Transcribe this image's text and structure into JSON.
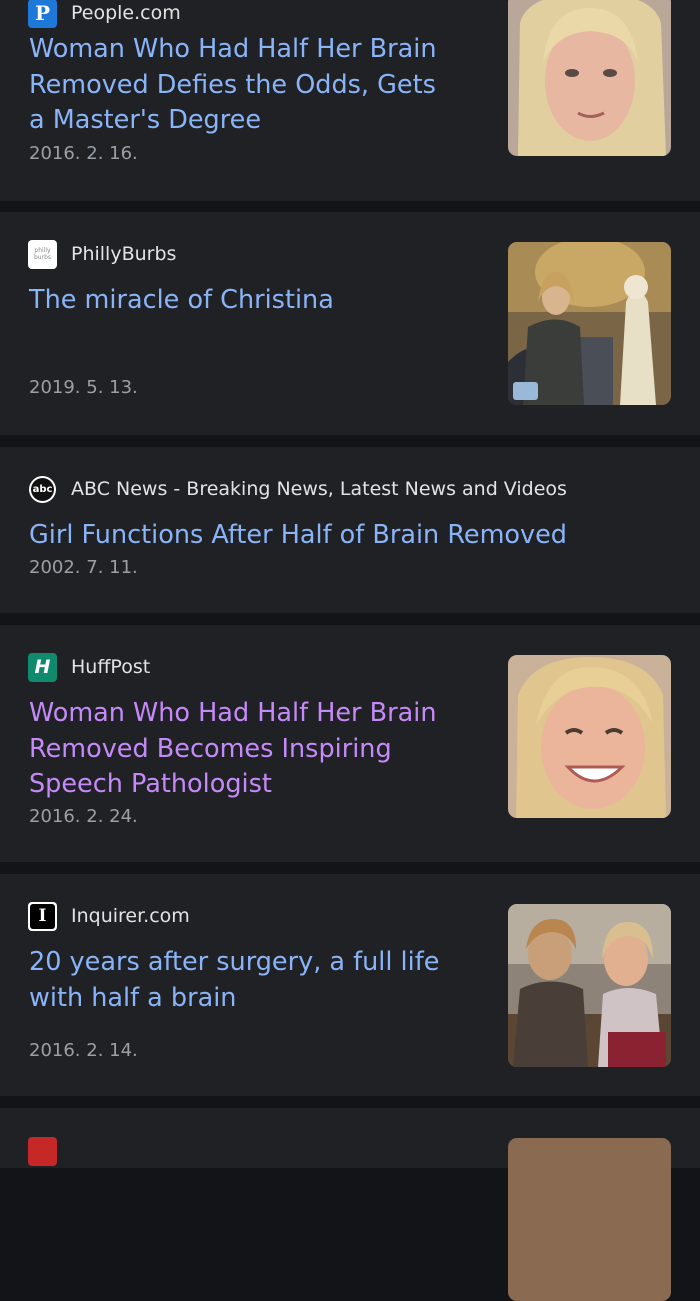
{
  "articles": [
    {
      "source": "People.com",
      "favicon_icon": "people-logo-icon",
      "title": "Woman Who Had Half Her Brain Removed Defies the Odds, Gets a Master's Degree",
      "date": "2016. 2. 16.",
      "visited": false,
      "thumbnail": "blonde-woman-portrait"
    },
    {
      "source": "PhillyBurbs",
      "favicon_icon": "phillyburbs-logo-icon",
      "title": "The miracle of Christina",
      "date": "2019. 5. 13.",
      "visited": false,
      "thumbnail": "woman-beside-statue"
    },
    {
      "source": "ABC News - Breaking News, Latest News and Videos",
      "favicon_icon": "abc-logo-icon",
      "title": "Girl Functions After Half of Brain Removed",
      "date": "2002. 7. 11.",
      "visited": false,
      "thumbnail": null
    },
    {
      "source": "HuffPost",
      "favicon_icon": "huffpost-logo-icon",
      "title": "Woman Who Had Half Her Brain Removed Becomes Inspiring Speech Pathologist",
      "date": "2016. 2. 24.",
      "visited": true,
      "thumbnail": "smiling-woman-portrait"
    },
    {
      "source": "Inquirer.com",
      "favicon_icon": "inquirer-logo-icon",
      "title": "20 years after surgery, a full life with half a brain",
      "date": "2016. 2. 14.",
      "visited": false,
      "thumbnail": "two-women-on-couch"
    }
  ],
  "favicons": {
    "people": "P",
    "phillyburbs": "philly burbs",
    "abc": "abc",
    "huffpost": "H",
    "inquirer": "I"
  },
  "colors": {
    "background": "#131418",
    "card": "#202125",
    "link": "#8ab4f8",
    "visited_link": "#c58af9",
    "source_text": "#e3e3e3",
    "date_text": "#9aa0a6"
  }
}
